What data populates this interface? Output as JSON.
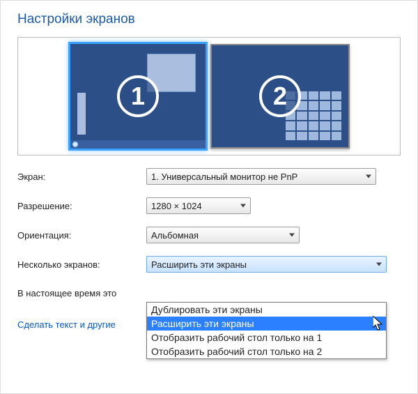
{
  "title": "Настройки экранов",
  "preview": {
    "monitor1_number": "1",
    "monitor2_number": "2"
  },
  "form": {
    "screen_label": "Экран:",
    "screen_value": "1. Универсальный монитор не PnP",
    "resolution_label": "Разрешение:",
    "resolution_value": "1280 × 1024",
    "orientation_label": "Ориентация:",
    "orientation_value": "Альбомная",
    "multi_label": "Несколько экранов:",
    "multi_value": "Расширить эти экраны"
  },
  "dropdown_options": [
    "Дублировать эти экраны",
    "Расширить эти экраны",
    "Отобразить рабочий стол только на 1",
    "Отобразить рабочий стол только на 2"
  ],
  "selected_option_index": 1,
  "note_text": "В настоящее время это",
  "link_text": "Сделать текст и другие"
}
